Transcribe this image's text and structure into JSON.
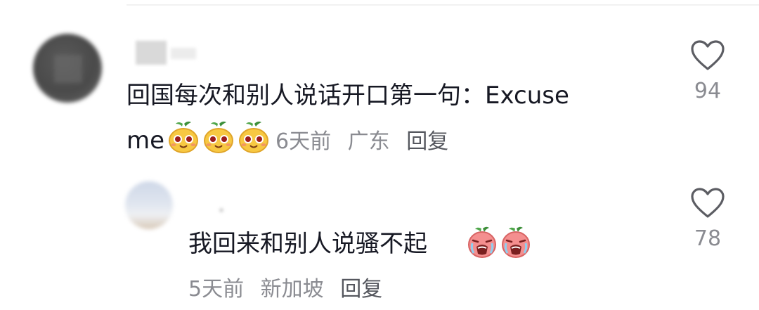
{
  "comments": [
    {
      "text_line1": "回国每次和别人说话开口第一句：Excuse",
      "text_line2": "me",
      "emoji": [
        "fruit-smile-emoji",
        "fruit-smile-emoji",
        "fruit-smile-emoji"
      ],
      "meta": {
        "time": "6天前",
        "location": "广东",
        "reply_label": "回复"
      },
      "likes": "94"
    },
    {
      "text": "我回来和别人说骚不起",
      "emoji": [
        "fruit-cry-emoji",
        "fruit-cry-emoji"
      ],
      "meta": {
        "time": "5天前",
        "location": "新加坡",
        "reply_label": "回复"
      },
      "likes": "78"
    }
  ]
}
